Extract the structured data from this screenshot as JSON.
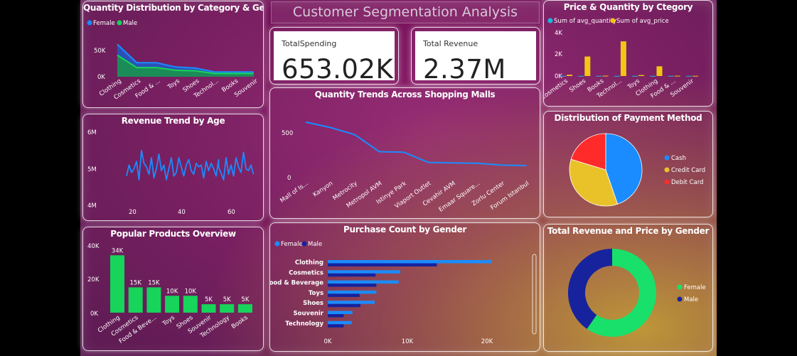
{
  "title": "Customer Segmentation Analysis",
  "colors": {
    "female": "#1a8cff",
    "male": "#17d45a",
    "dark_blue": "#16239c",
    "yellow": "#f3c515",
    "cyan": "#19b8e6",
    "red": "#ff2a2a",
    "credit": "#e9c22a",
    "donut_female": "#19e06a"
  },
  "cards": {
    "spending_label": "TotalSpending",
    "spending_value": "653.02K",
    "revenue_label": "Total Revenue",
    "revenue_value": "2.37M"
  },
  "qty_by_category": {
    "title": "Quantity Distribution by Category & Gender",
    "legend": [
      "Female",
      "Male"
    ],
    "y_ticks": [
      "50K",
      "0K"
    ],
    "categories": [
      "Clothing",
      "Cosmetics",
      "Food & ...",
      "Toys",
      "Shoes",
      "Technol...",
      "Books",
      "Souvenir"
    ]
  },
  "revenue_age": {
    "title": "Revenue Trend by Age",
    "y_ticks": [
      "6M",
      "5M",
      "4M"
    ],
    "x_ticks": [
      "20",
      "40",
      "60"
    ]
  },
  "popular_products": {
    "title": "Popular Products Overview",
    "y_ticks": [
      "40K",
      "20K",
      "0K"
    ],
    "categories": [
      "Clothing",
      "Cosmetics",
      "Food & Beve...",
      "Toys",
      "Shoes",
      "Souvenir",
      "Technology",
      "Books"
    ],
    "labels": [
      "34K",
      "15K",
      "15K",
      "10K",
      "10K",
      "5K",
      "5K",
      "5K"
    ]
  },
  "mall_trends": {
    "title": "Quantity Trends Across Shopping Malls",
    "y_ticks": [
      "500",
      "0"
    ],
    "categories": [
      "Mall of Is...",
      "Kanyon",
      "Metrocity",
      "Metropol AVM",
      "Istinye Park",
      "Viaport Outlet",
      "Cevahir AVM",
      "Emaar Square...",
      "Zorlu Center",
      "Forum Istanbul"
    ]
  },
  "gender_purchase": {
    "title": "Purchase Count by Gender",
    "legend": [
      "Female",
      "Male"
    ],
    "categories": [
      "Clothing",
      "Cosmetics",
      "Food & Beverage",
      "Toys",
      "Shoes",
      "Souvenir",
      "Technology"
    ],
    "x_ticks": [
      "0K",
      "10K",
      "20K"
    ]
  },
  "price_quantity": {
    "title": "Price & Quantity by Ctegory",
    "legend": [
      "Sum of avg_quantity",
      "Sum of avg_price"
    ],
    "y_ticks": [
      "4K",
      "2K",
      "0K"
    ],
    "categories": [
      "Cosmetics",
      "Shoes",
      "Books",
      "Technol...",
      "Toys",
      "Clothing",
      "Food & ...",
      "Souvenir"
    ]
  },
  "payment": {
    "title": "Distribution of Payment Method",
    "legend": [
      "Cash",
      "Credit Card",
      "Debit Card"
    ]
  },
  "revenue_gender": {
    "title": "Total Revenue and Price by Gender",
    "legend": [
      "Female",
      "Male"
    ]
  },
  "chart_data": [
    {
      "type": "area",
      "title": "Quantity Distribution by Category & Gender",
      "categories": [
        "Clothing",
        "Cosmetics",
        "Food & ...",
        "Toys",
        "Shoes",
        "Technol...",
        "Books",
        "Souvenir"
      ],
      "series": [
        {
          "name": "Female",
          "values": [
            60000,
            26000,
            26000,
            18000,
            16000,
            9000,
            9000,
            9000
          ]
        },
        {
          "name": "Male",
          "values": [
            40000,
            17000,
            17000,
            12000,
            11000,
            6000,
            6000,
            6000
          ]
        }
      ],
      "ylim": [
        0,
        75000
      ]
    },
    {
      "type": "line",
      "title": "Revenue Trend by Age",
      "xlim": [
        18,
        69
      ],
      "ylim": [
        4000000,
        6000000
      ],
      "x": [
        18,
        19,
        20,
        21,
        22,
        23,
        24,
        25,
        26,
        27,
        28,
        29,
        30,
        31,
        32,
        33,
        34,
        35,
        36,
        37,
        38,
        39,
        40,
        41,
        42,
        43,
        44,
        45,
        46,
        47,
        48,
        49,
        50,
        51,
        52,
        53,
        54,
        55,
        55,
        57,
        58,
        59,
        60,
        61,
        62,
        63,
        64,
        65,
        66,
        67,
        68,
        69
      ],
      "y": [
        4800000,
        5100000,
        4900000,
        5000000,
        5200000,
        4700000,
        5500000,
        5150000,
        5050000,
        4850000,
        5300000,
        4750000,
        5000000,
        5400000,
        4950000,
        5100000,
        4700000,
        5000000,
        5300000,
        4800000,
        4900000,
        5300000,
        5050000,
        4800000,
        5100000,
        5250000,
        4950000,
        4850000,
        5150000,
        5050000,
        5100000,
        4750000,
        5200000,
        4950000,
        5150000,
        5000000,
        4800000,
        5250000,
        5050000,
        4700000,
        5300000,
        4850000,
        5100000,
        4800000,
        5300000,
        5050000,
        4900000,
        5450000,
        5000000,
        4950000,
        5100000,
        4850000
      ]
    },
    {
      "type": "bar",
      "title": "Popular Products Overview",
      "categories": [
        "Clothing",
        "Cosmetics",
        "Food & Beve...",
        "Toys",
        "Shoes",
        "Souvenir",
        "Technology",
        "Books"
      ],
      "values": [
        34000,
        15000,
        15000,
        10000,
        10000,
        5000,
        5000,
        5000
      ],
      "ylim": [
        0,
        40000
      ]
    },
    {
      "type": "line",
      "title": "Quantity Trends Across Shopping Malls",
      "categories": [
        "Mall of Is...",
        "Kanyon",
        "Metrocity",
        "Metropol AVM",
        "Istinye Park",
        "Viaport Outlet",
        "Cevahir AVM",
        "Emaar Square...",
        "Zorlu Center",
        "Forum Istanbul"
      ],
      "values": [
        620,
        560,
        480,
        290,
        285,
        170,
        165,
        160,
        140,
        135
      ],
      "ylim": [
        0,
        700
      ]
    },
    {
      "type": "bar",
      "title": "Purchase Count by Gender",
      "orientation": "horizontal",
      "categories": [
        "Clothing",
        "Cosmetics",
        "Food & Beverage",
        "Toys",
        "Shoes",
        "Souvenir",
        "Technology"
      ],
      "series": [
        {
          "name": "Female",
          "values": [
            20600,
            9100,
            8900,
            6100,
            5900,
            3100,
            3000
          ]
        },
        {
          "name": "Male",
          "values": [
            13700,
            6000,
            6100,
            4000,
            4100,
            2000,
            2000
          ]
        }
      ],
      "xlim": [
        0,
        25000
      ]
    },
    {
      "type": "bar",
      "title": "Price & Quantity by Ctegory",
      "categories": [
        "Cosmetics",
        "Shoes",
        "Books",
        "Technol...",
        "Toys",
        "Clothing",
        "Food & ...",
        "Souvenir"
      ],
      "series": [
        {
          "name": "Sum of avg_quantity",
          "values": [
            15,
            15,
            15,
            15,
            15,
            15,
            15,
            15
          ]
        },
        {
          "name": "Sum of avg_price",
          "values": [
            120,
            1800,
            30,
            3200,
            90,
            900,
            30,
            20
          ]
        }
      ],
      "ylim": [
        0,
        4000
      ]
    },
    {
      "type": "pie",
      "title": "Distribution of Payment Method",
      "categories": [
        "Cash",
        "Credit Card",
        "Debit Card"
      ],
      "values": [
        44.7,
        35.0,
        20.3
      ]
    },
    {
      "type": "pie",
      "title": "Total Revenue and Price by Gender",
      "categories": [
        "Female",
        "Male"
      ],
      "values": [
        59.7,
        40.3
      ]
    }
  ]
}
